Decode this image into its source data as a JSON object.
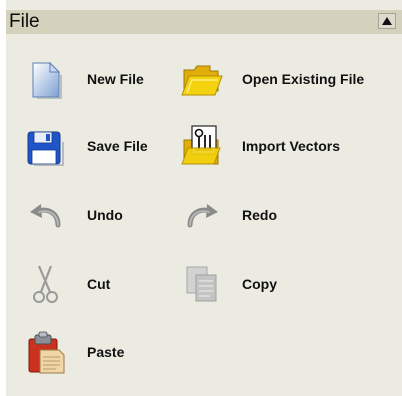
{
  "panel": {
    "title": "File",
    "collapse_icon": "triangle-up-icon"
  },
  "actions": [
    {
      "label": "New File",
      "icon": "new-file-icon"
    },
    {
      "label": "Open Existing File",
      "icon": "open-folder-icon"
    },
    {
      "label": "Save File",
      "icon": "floppy-disk-icon"
    },
    {
      "label": "Import Vectors",
      "icon": "import-vectors-icon"
    },
    {
      "label": "Undo",
      "icon": "undo-arrow-icon"
    },
    {
      "label": "Redo",
      "icon": "redo-arrow-icon"
    },
    {
      "label": "Cut",
      "icon": "scissors-icon"
    },
    {
      "label": "Copy",
      "icon": "copy-pages-icon"
    },
    {
      "label": "Paste",
      "icon": "clipboard-icon"
    }
  ],
  "colors": {
    "panel_background": "#ecebe2",
    "header_background": "#d4d1bd",
    "folder_yellow": "#f4d20f",
    "floppy_blue": "#1f55c8",
    "paste_red": "#c8321e"
  }
}
